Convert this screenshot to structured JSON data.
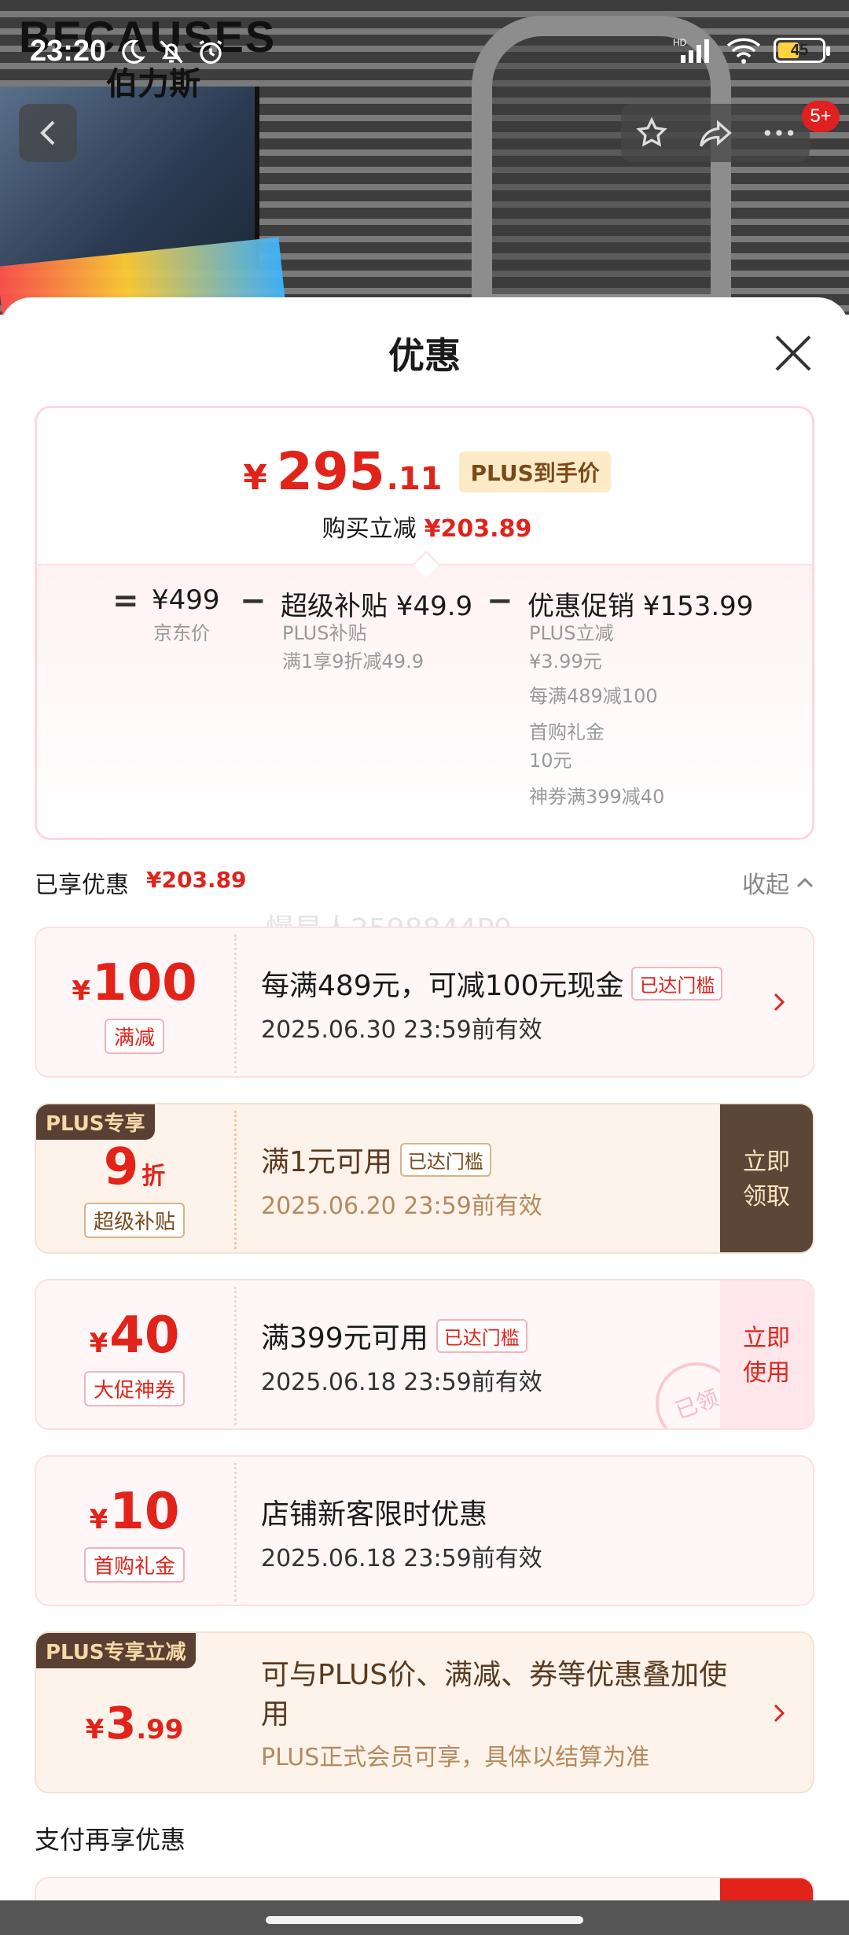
{
  "status_bar": {
    "time": "23:20",
    "battery": "45",
    "network": "HD"
  },
  "photo": {
    "brand": "BECAUSES",
    "brand_sub": "伯力斯"
  },
  "nav": {
    "badge": "5+"
  },
  "sheet": {
    "title": "优惠"
  },
  "summary": {
    "price_yen": "¥",
    "price_int": "295",
    "price_dec": ".11",
    "price_tag": "PLUS到手价",
    "saved_label": "购买立减",
    "saved_amount": "¥203.89",
    "calc": {
      "eq": "=",
      "base_price": "¥499",
      "base_label": "京东价",
      "minus1": "−",
      "subsidy_title": "超级补贴 ¥49.9",
      "subsidy_sub1": "PLUS补贴",
      "subsidy_sub2": "满1享9折减49.9",
      "minus2": "−",
      "promo_title": "优惠促销 ¥153.99",
      "promo_items": [
        "PLUS立减",
        "¥3.99元",
        "每满489减100",
        "首购礼金",
        "10元",
        "神券满399减40"
      ]
    }
  },
  "enjoyed": {
    "label": "已享优惠",
    "amount": "¥203.89",
    "collapse": "收起"
  },
  "watermark": "慢星人2598844P0",
  "coupons": [
    {
      "yen": "¥",
      "num": "100",
      "tag": "满减",
      "title": "每满489元，可减100元现金",
      "badge": "已达门槛",
      "validity": "2025.06.30 23:59前有效"
    },
    {
      "corner": "PLUS专享",
      "num": "9",
      "unit": "折",
      "tag": "超级补贴",
      "title": "满1元可用",
      "badge": "已达门槛",
      "validity": "2025.06.20 23:59前有效",
      "cta": "立即领取"
    },
    {
      "yen": "¥",
      "num": "40",
      "tag": "大促神券",
      "title": "满399元可用",
      "badge": "已达门槛",
      "validity": "2025.06.18 23:59前有效",
      "cta": "立即使用",
      "stamp": "已领"
    },
    {
      "yen": "¥",
      "num": "10",
      "tag": "首购礼金",
      "title": "店铺新客限时优惠",
      "validity": "2025.06.18 23:59前有效"
    },
    {
      "corner": "PLUS专享立减",
      "yen": "¥",
      "num": "3",
      "dec": ".99",
      "title": "可与PLUS价、满减、券等优惠叠加使用",
      "validity": "PLUS正式会员可享，具体以结算为准"
    }
  ],
  "pay": {
    "title": "支付再享优惠"
  },
  "colors": {
    "accent_red": "#e2231a",
    "plus_brown": "#5c4638",
    "plus_gold": "#fdebc8"
  }
}
